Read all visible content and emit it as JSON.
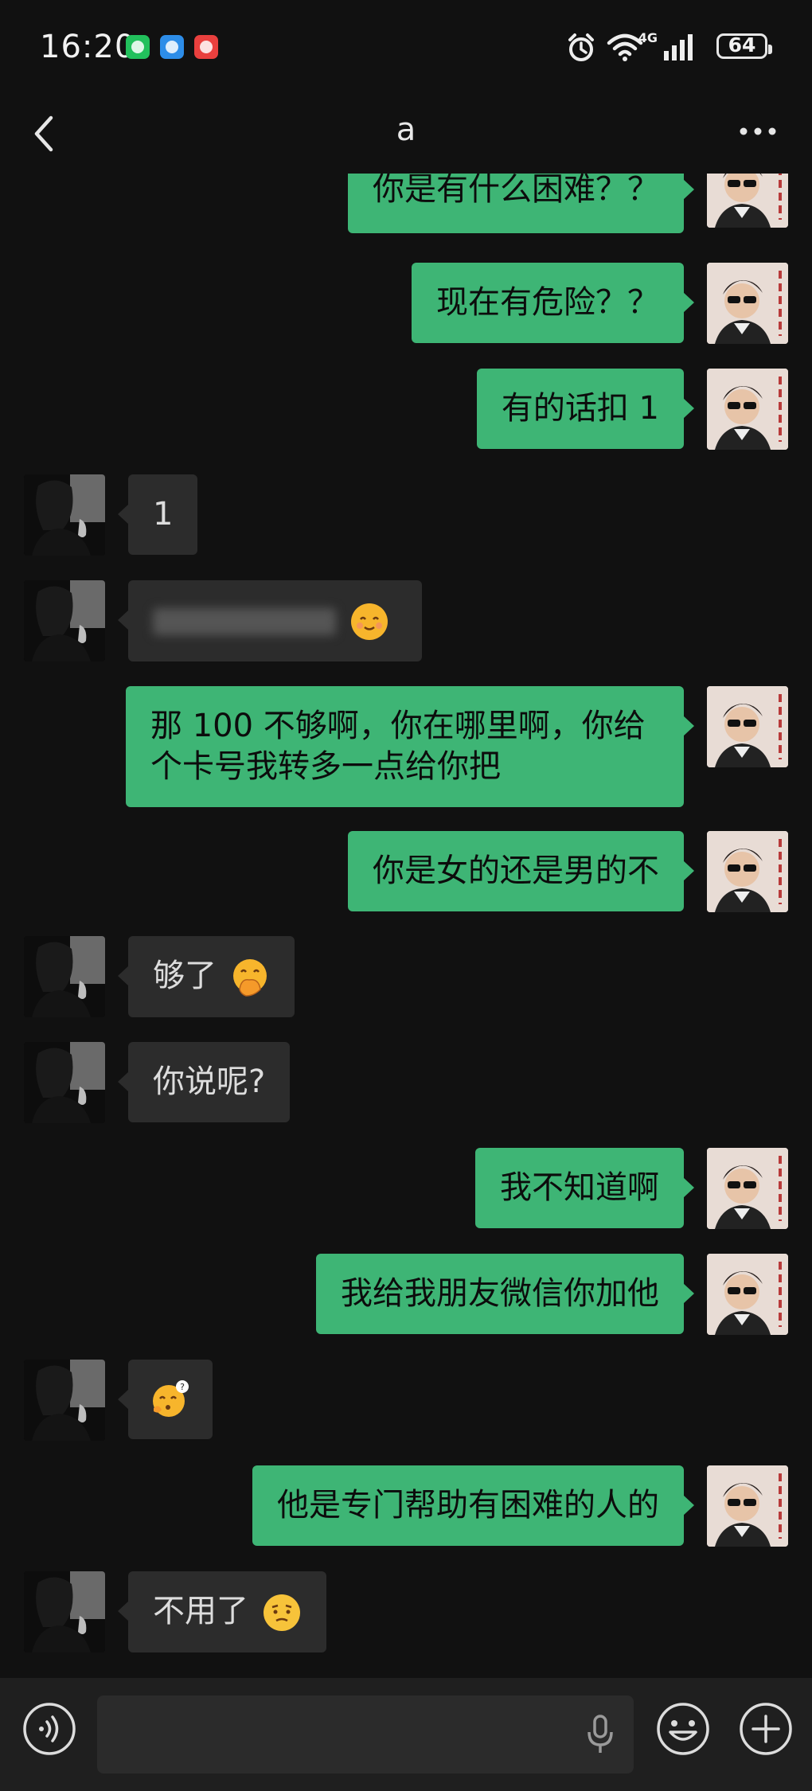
{
  "status_bar": {
    "time": "16:20",
    "app_badges": [
      "wechat-icon",
      "browser-icon",
      "game-icon"
    ],
    "network_label": "4G",
    "battery_level": "64"
  },
  "header": {
    "title": "a",
    "back_icon": "chevron-left-icon",
    "more_icon": "more-dots-icon"
  },
  "messages": [
    {
      "sender": "me",
      "text": "你是有什么困难？？"
    },
    {
      "sender": "me",
      "text": "现在有危险？？"
    },
    {
      "sender": "me",
      "text": "有的话扣 1"
    },
    {
      "sender": "them",
      "text": "1"
    },
    {
      "sender": "them",
      "text": "",
      "emoji": "smiling-face-emoji"
    },
    {
      "sender": "me",
      "text": "那 100 不够啊，你在哪里啊，你给个卡号我转多一点给你把"
    },
    {
      "sender": "me",
      "text": "你是女的还是男的不"
    },
    {
      "sender": "them",
      "text": "够了",
      "emoji": "hand-over-mouth-emoji"
    },
    {
      "sender": "them",
      "text": "你说呢?"
    },
    {
      "sender": "me",
      "text": "我不知道啊"
    },
    {
      "sender": "me",
      "text": "我给我朋友微信你加他"
    },
    {
      "sender": "them",
      "text": "",
      "emoji": "confused-question-emoji"
    },
    {
      "sender": "me",
      "text": "他是专门帮助有困难的人的"
    },
    {
      "sender": "them",
      "text": "不用了",
      "emoji": "puzzled-face-emoji"
    }
  ],
  "input_bar": {
    "voice_icon": "voice-toggle-icon",
    "mic_icon": "microphone-icon",
    "emoji_icon": "emoji-icon",
    "plus_icon": "plus-icon"
  },
  "colors": {
    "background": "#111111",
    "my_bubble": "#3eb575",
    "their_bubble": "#2c2c2c"
  }
}
